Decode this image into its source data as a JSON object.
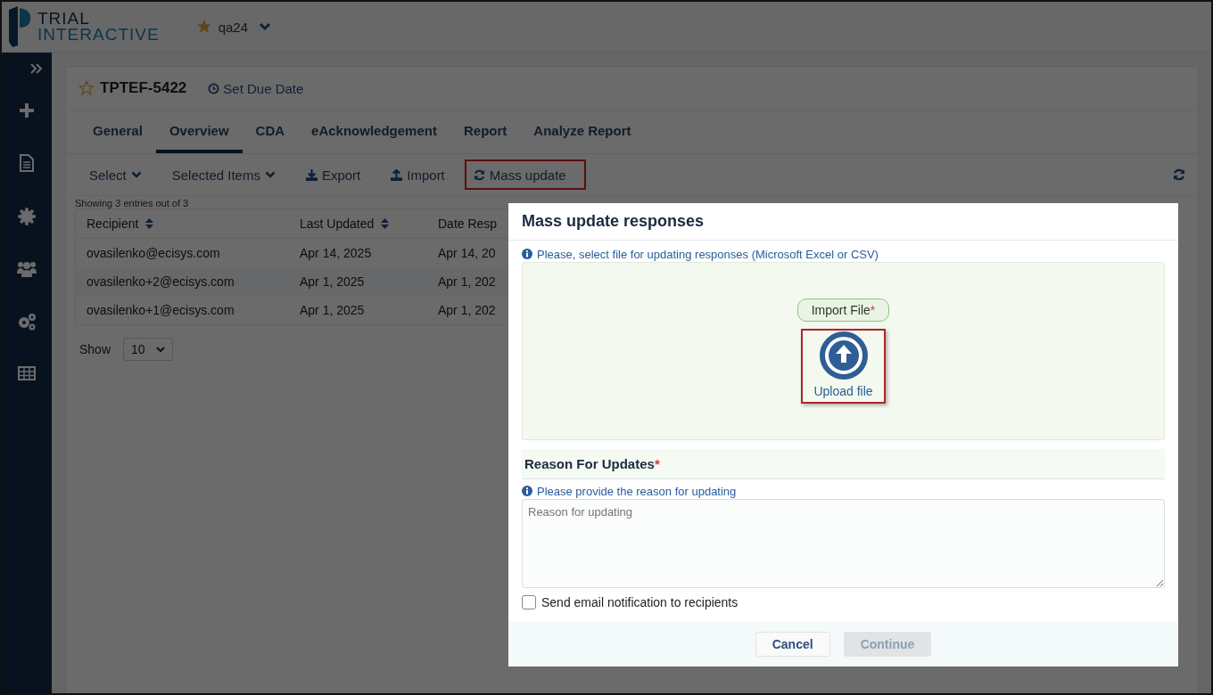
{
  "header": {
    "logo": {
      "line1": "TRIAL",
      "line2": "INTERACTIVE"
    },
    "workspace": {
      "name": "qa24",
      "favorite": true
    }
  },
  "record": {
    "id": "TPTEF-5422",
    "favorite": false,
    "due_date_link": "Set Due Date"
  },
  "tabs": [
    {
      "label": "General",
      "selected": false
    },
    {
      "label": "Overview",
      "selected": true
    },
    {
      "label": "CDA",
      "selected": false
    },
    {
      "label": "eAcknowledgement",
      "selected": false
    },
    {
      "label": "Report",
      "selected": false
    },
    {
      "label": "Analyze Report",
      "selected": false
    }
  ],
  "toolbar": [
    {
      "label": "Select",
      "kind": "dropdown",
      "highlighted": false
    },
    {
      "label": "Selected Items",
      "kind": "dropdown",
      "highlighted": false
    },
    {
      "label": "Export",
      "kind": "export",
      "highlighted": false
    },
    {
      "label": "Import",
      "kind": "import",
      "highlighted": false
    },
    {
      "label": "Mass update",
      "kind": "update",
      "highlighted": true
    }
  ],
  "table": {
    "summary": "Showing 3 entries out of 3",
    "columns": [
      {
        "label": "Recipient",
        "sortable": true
      },
      {
        "label": "Last Updated",
        "sortable": true
      },
      {
        "label": "Date Resp",
        "sortable": false
      }
    ],
    "rows": [
      [
        "ovasilenko@ecisys.com",
        "Apr 14, 2025",
        "Apr 14, 20"
      ],
      [
        "ovasilenko+2@ecisys.com",
        "Apr 1, 2025",
        "Apr 1, 202"
      ],
      [
        "ovasilenko+1@ecisys.com",
        "Apr 1, 2025",
        "Apr 1, 202"
      ]
    ]
  },
  "page_size": {
    "label": "Show",
    "value": "10"
  },
  "modal": {
    "title": "Mass update responses",
    "file_hint": "Please, select file for updating responses (Microsoft Excel or CSV)",
    "import_label": "Import File",
    "import_required_mark": "*",
    "upload_label": "Upload file",
    "upload_highlighted": true,
    "reason_title": "Reason For Updates",
    "reason_required_mark": "*",
    "reason_hint": "Please provide the reason for updating",
    "reason_placeholder": "Reason for updating",
    "notify": {
      "label": "Send email notification to recipients",
      "checked": false
    },
    "buttons": [
      {
        "label": "Cancel",
        "disabled": false
      },
      {
        "label": "Continue",
        "disabled": true
      }
    ]
  }
}
